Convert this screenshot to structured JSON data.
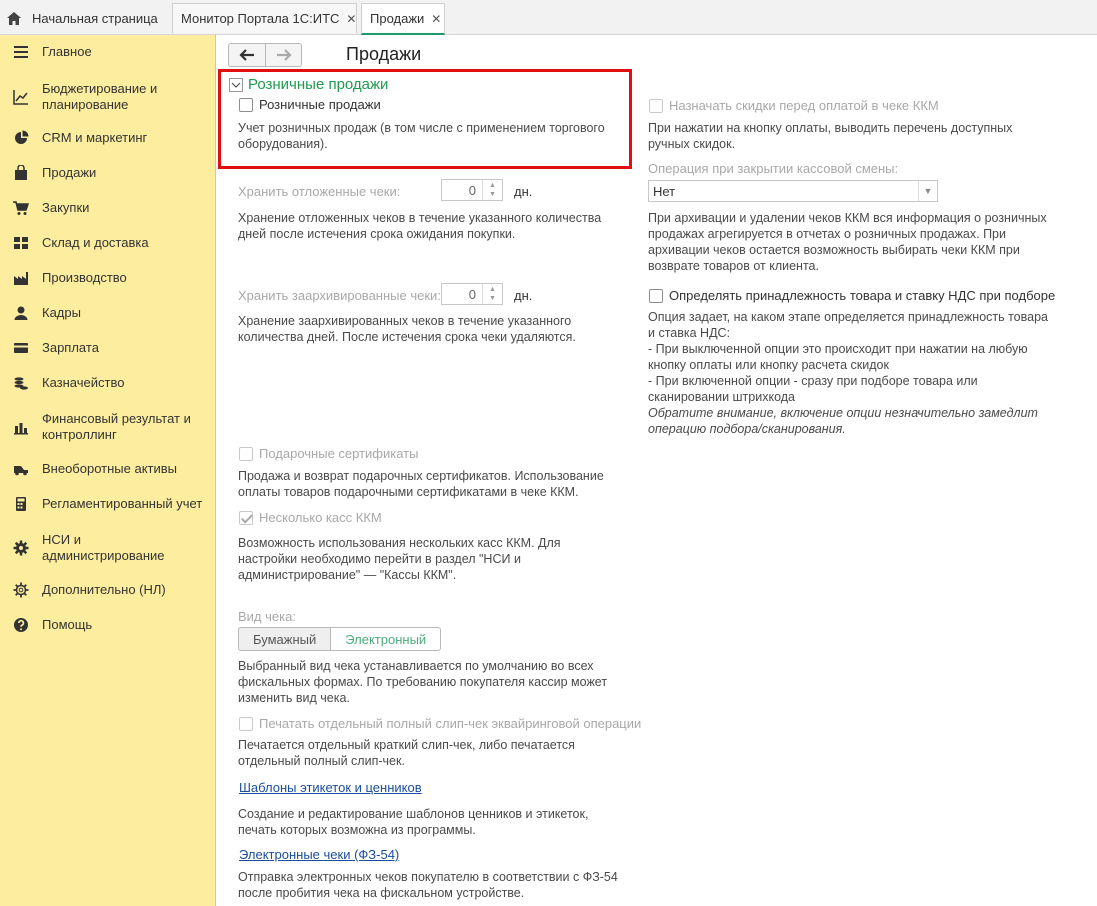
{
  "tabs": [
    {
      "label": "Начальная страница"
    },
    {
      "label": "Монитор Портала 1С:ИТС"
    },
    {
      "label": "Продажи"
    }
  ],
  "close_glyph": "✕",
  "sidebar": {
    "items": [
      {
        "label": "Главное",
        "icon": "menu-icon"
      },
      {
        "label": "Бюджетирование и планирование",
        "icon": "chart-trend-icon"
      },
      {
        "label": "CRM и маркетинг",
        "icon": "pie-chart-icon"
      },
      {
        "label": "Продажи",
        "icon": "shopping-bag-icon"
      },
      {
        "label": "Закупки",
        "icon": "cart-icon"
      },
      {
        "label": "Склад и доставка",
        "icon": "grid-icon"
      },
      {
        "label": "Производство",
        "icon": "factory-icon"
      },
      {
        "label": "Кадры",
        "icon": "person-icon"
      },
      {
        "label": "Зарплата",
        "icon": "card-icon"
      },
      {
        "label": "Казначейство",
        "icon": "coins-icon"
      },
      {
        "label": "Финансовый результат и контроллинг",
        "icon": "bar-chart-icon"
      },
      {
        "label": "Внеоборотные активы",
        "icon": "truck-icon"
      },
      {
        "label": "Регламентированный учет",
        "icon": "calculator-icon"
      },
      {
        "label": "НСИ и администрирование",
        "icon": "gear-icon"
      },
      {
        "label": "Дополнительно (НЛ)",
        "icon": "gear-outline-icon"
      },
      {
        "label": "Помощь",
        "icon": "help-icon"
      }
    ]
  },
  "page": {
    "title": "Продажи",
    "section_title": "Розничные продажи",
    "retail_checkbox": "Розничные продажи",
    "retail_desc": "Учет розничных продаж (в том числе с применением торгового оборудования).",
    "postponed_label": "Хранить отложенные чеки:",
    "postponed_value": "0",
    "days_unit": "дн.",
    "postponed_desc": "Хранение отложенных чеков в течение указанного количества дней после истечения срока ожидания покупки.",
    "archived_label": "Хранить заархивированные чеки:",
    "archived_value": "0",
    "archived_desc": "Хранение заархивированных чеков в течение указанного количества дней. После истечения срока чеки удаляются.",
    "gift_checkbox": "Подарочные сертификаты",
    "gift_desc": "Продажа и возврат подарочных сертификатов. Использование оплаты товаров подарочными сертификатами в чеке ККМ.",
    "multi_kkm_checkbox": "Несколько касс ККМ",
    "multi_kkm_desc": "Возможность использования нескольких касс ККМ. Для настройки необходимо перейти в раздел \"НСИ и администрирование\" — \"Кассы ККМ\".",
    "receipt_type_label": "Вид чека:",
    "receipt_type_options": [
      "Бумажный",
      "Электронный"
    ],
    "receipt_type_desc": "Выбранный вид чека устанавливается по умолчанию во всех фискальных формах. По требованию покупателя кассир может изменить вид чека.",
    "slip_checkbox": "Печатать отдельный полный слип-чек эквайринговой операции",
    "slip_desc": "Печатается отдельный краткий слип-чек, либо печатается отдельный полный слип-чек.",
    "templates_link": "Шаблоны этикеток и ценников",
    "templates_desc": "Создание и редактирование шаблонов ценников и этикеток, печать которых возможна из программы.",
    "echecks_link": "Электронные чеки (ФЗ-54)",
    "echecks_desc": "Отправка электронных чеков покупателю в соответствии с ФЗ-54 после пробития чека на фискальном устройстве.",
    "discounts_checkbox": "Назначать скидки перед оплатой в чеке ККМ",
    "discounts_desc": "При нажатии на кнопку оплаты, выводить перечень доступных ручных скидок.",
    "shift_close_label": "Операция при закрытии кассовой смены:",
    "shift_close_value": "Нет",
    "shift_close_desc": "При архивации и удалении чеков ККМ вся информация о розничных продажах агрегируется в отчетах о розничных продажах. При архивации чеков остается возможность выбирать чеки ККМ при возврате товаров от клиента.",
    "vat_checkbox": "Определять принадлежность товара и ставку НДС при подборе",
    "vat_desc_1": "Опция задает, на каком этапе определяется принадлежность товара и ставка НДС:",
    "vat_desc_2": "- При выключенной опции это происходит при нажатии на любую кнопку оплаты или кнопку расчета скидок",
    "vat_desc_3": "- При включенной опции - сразу при подборе товара или сканировании штрихкода",
    "vat_desc_note": "Обратите внимание, включение опции незначительно замедлит операцию подбора/сканирования."
  }
}
